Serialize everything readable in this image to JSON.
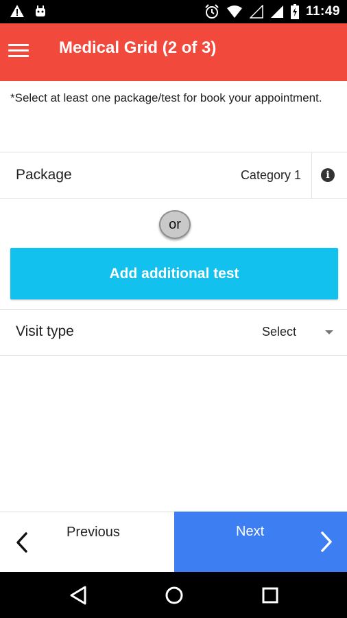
{
  "status_bar": {
    "time": "11:49",
    "icons": [
      "warning-icon",
      "android-icon",
      "alarm-icon",
      "wifi-icon",
      "cell-signal-empty-icon",
      "cell-signal-full-icon",
      "battery-charging-icon"
    ]
  },
  "app_bar": {
    "title": "Medical Grid (2 of 3)",
    "menu_icon": "hamburger-menu-icon",
    "background": "#f1493c"
  },
  "instruction": "*Select at least one package/test for book your appointment.",
  "package": {
    "label": "Package",
    "value": "Category 1",
    "info_icon": "info-icon"
  },
  "or_label": "or",
  "add_test_button": {
    "label": "Add additional test",
    "color": "#13c1ee"
  },
  "visit_type": {
    "label": "Visit type",
    "selected": "Select"
  },
  "navigation": {
    "previous_label": "Previous",
    "next_label": "Next",
    "next_color": "#3e7ef3"
  },
  "system_nav": {
    "buttons": [
      "back-icon",
      "home-icon",
      "recents-icon"
    ]
  }
}
